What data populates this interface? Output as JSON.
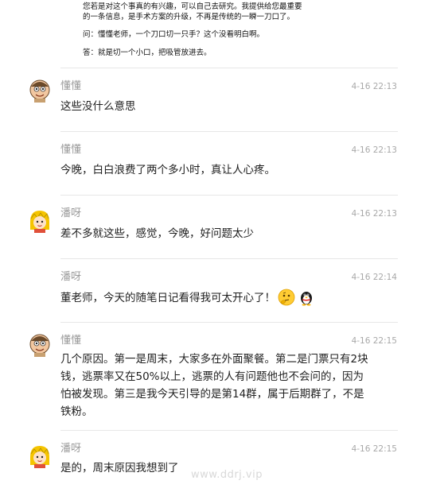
{
  "article_excerpt": {
    "line1": "您若是对这个事真的有兴趣，可以自己去研究。我提供给您最重要",
    "line2": "的一条信息，是手术方案的升级，不再是传统的一瞬一刀口了。",
    "question": "问：懂懂老师，一个刀口切一只手？这个没看明白啊。",
    "answer": "答：就是切一个小口，把吸管放进去。"
  },
  "comments": [
    {
      "author": "懂懂",
      "time": "4-16 22:13",
      "text": "这些没什么意思",
      "avatar": "dongdong-avatar-icon"
    },
    {
      "author": "懂懂",
      "time": "4-16 22:13",
      "text": "今晚，白白浪费了两个多小时，真让人心疼。"
    },
    {
      "author": "潘呀",
      "time": "4-16 22:13",
      "text": "差不多就这些，感觉，今晚，好问题太少",
      "avatar": "panya-avatar-icon"
    },
    {
      "author": "潘呀",
      "time": "4-16 22:14",
      "text": "董老师，今天的随笔日记看得我可太开心了！",
      "emojis": [
        "thinking-face-emoji-icon",
        "penguin-emoji-icon"
      ]
    },
    {
      "author": "懂懂",
      "time": "4-16 22:15",
      "text_lines": [
        "几个原因。第一是周末，大家多在外面聚餐。第二是门票只有2块",
        "钱，逃票率又在50%以上，逃票的人有问题他也不会问的，因为",
        "怕被发现。第三是我今天引导的是第14群，属于后期群了，不是",
        "铁粉。"
      ],
      "avatar": "dongdong-avatar-icon"
    },
    {
      "author": "潘呀",
      "time": "4-16 22:15",
      "text": "是的，周末原因我想到了",
      "avatar": "panya-avatar-icon"
    }
  ],
  "watermark": "www.ddrj.vip"
}
